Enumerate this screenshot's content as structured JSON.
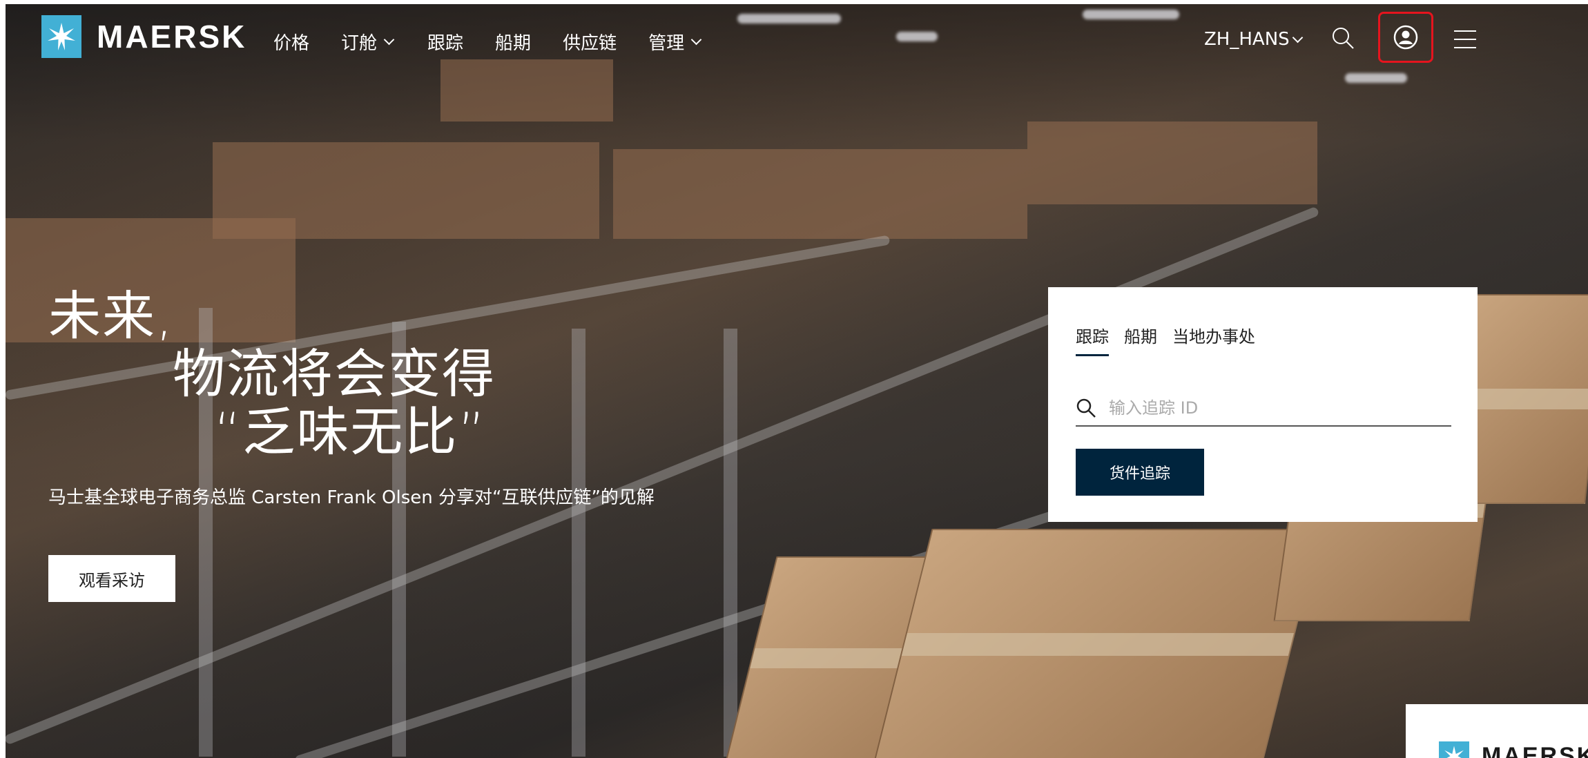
{
  "brand": {
    "name": "MAERSK",
    "color": "#42b0d5",
    "logo_icon": "star-icon"
  },
  "nav": {
    "items": [
      {
        "label": "价格",
        "dropdown": false
      },
      {
        "label": "订舱",
        "dropdown": true
      },
      {
        "label": "跟踪",
        "dropdown": false
      },
      {
        "label": "船期",
        "dropdown": false
      },
      {
        "label": "供应链",
        "dropdown": false
      },
      {
        "label": "管理",
        "dropdown": true
      }
    ],
    "language": "ZH_HANS",
    "search_icon": "search-icon",
    "profile_icon": "user-circle-icon",
    "menu_icon": "hamburger-menu-icon",
    "highlight_color": "#e5141e"
  },
  "hero": {
    "headline_line1": "未来,",
    "headline_line2": "物流将会变得",
    "headline_line3": "“乏味无比”",
    "subline": "马士基全球电子商务总监 Carsten Frank Olsen 分享对“互联供应链”的见解",
    "cta_label": "观看采访"
  },
  "tracking": {
    "tabs": [
      {
        "label": "跟踪",
        "active": true
      },
      {
        "label": "船期",
        "active": false
      },
      {
        "label": "当地办事处",
        "active": false
      }
    ],
    "input_placeholder": "输入追踪 ID",
    "button_label": "货件追踪",
    "accent_color": "#00243d"
  },
  "popup": {
    "brand_partial": "MAERSK"
  }
}
